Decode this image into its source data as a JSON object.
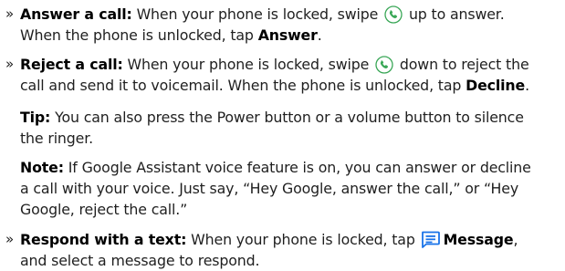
{
  "items": [
    {
      "bullet": "»",
      "title": "Answer a call:",
      "text1": " When your phone is locked, swipe ",
      "icon": "green-phone-icon",
      "text2": " up to answer.",
      "text3": "When the phone is unlocked, tap ",
      "strong": "Answer",
      "text4": "."
    },
    {
      "bullet": "»",
      "title": "Reject a call:",
      "text1": " When your phone is locked, swipe ",
      "icon": "green-phone-icon",
      "text2": " down to reject the",
      "text3": "call and send it to voicemail. When the phone is unlocked, tap ",
      "strong": "Decline",
      "text4": "."
    }
  ],
  "tip": {
    "label": "Tip:",
    "line1": " You can also press the Power button or a volume button to silence",
    "line2": "the ringer."
  },
  "note": {
    "label": "Note:",
    "line1": " If Google Assistant voice feature is on, you can answer or decline",
    "line2": "a call with your voice. Just say, “Hey Google, answer the call,” or “Hey",
    "line3": "Google, reject the call.”"
  },
  "respond": {
    "bullet": "»",
    "title": "Respond with a text:",
    "text1": " When your phone is locked, tap ",
    "icon": "message-icon",
    "strong": "Message",
    "text2": ",",
    "line2": "and select a message to respond."
  },
  "colors": {
    "text": "#1f1f1f",
    "icon_green": "#3aa757",
    "icon_blue": "#1a73e8"
  }
}
